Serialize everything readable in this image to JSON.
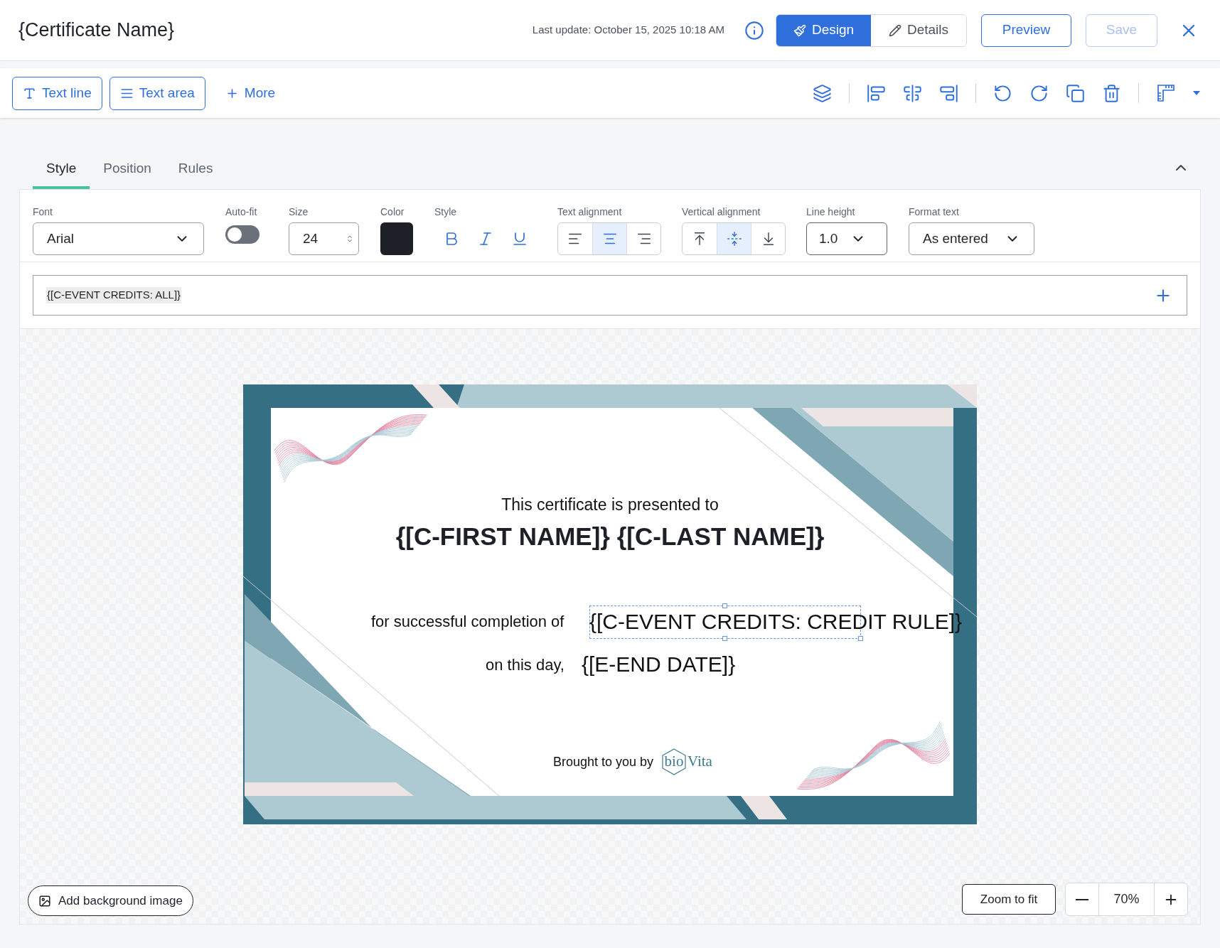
{
  "header": {
    "title": "{Certificate Name}",
    "last_update": "Last update: October 15, 2025 10:18 AM",
    "mode_tabs": [
      {
        "kind": "design",
        "label": "Design",
        "selected": true
      },
      {
        "kind": "details",
        "label": "Details",
        "selected": false
      }
    ],
    "preview": "Preview",
    "save": {
      "label": "Save",
      "disabled": true
    }
  },
  "toolbar": {
    "add_buttons": [
      {
        "kind": "text_line",
        "label": "Text line"
      },
      {
        "kind": "text_area",
        "label": "Text area"
      },
      {
        "kind": "more",
        "label": "More"
      }
    ]
  },
  "panel_tabs": [
    {
      "label": "Style",
      "selected": true
    },
    {
      "label": "Position",
      "selected": false
    },
    {
      "label": "Rules",
      "selected": false
    }
  ],
  "style": {
    "font": {
      "label": "Font",
      "value": "Arial"
    },
    "auto_fit": {
      "label": "Auto-fit",
      "on": false
    },
    "size": {
      "label": "Size",
      "value": "24"
    },
    "color": {
      "label": "Color",
      "color": "#1d2127"
    },
    "text_style": {
      "label": "Style"
    },
    "text_alignment": {
      "label": "Text alignment",
      "options": [
        {
          "kind": "left",
          "selected": false
        },
        {
          "kind": "center",
          "selected": true
        },
        {
          "kind": "right",
          "selected": false
        }
      ]
    },
    "vertical_alignment": {
      "label": "Vertical alignment",
      "options": [
        {
          "kind": "top",
          "selected": false
        },
        {
          "kind": "middle",
          "selected": true
        },
        {
          "kind": "bottom",
          "selected": false
        }
      ]
    },
    "line_height": {
      "label": "Line height",
      "value": "1.0"
    },
    "format_text": {
      "label": "Format text",
      "value": "As entered"
    }
  },
  "text_value": "{[C-EVENT CREDITS: ALL]}",
  "certificate": {
    "presented": "This certificate is presented to",
    "name": "{[C-FIRST NAME]} {[C-LAST NAME]}",
    "completion": "for successful completion of",
    "credit_field": "{[C-EVENT CREDITS: CREDIT RULE]}",
    "day": "on this day,",
    "date_field": "{[E-END DATE]}",
    "brought": "Brought to you by",
    "logo_left": "bio",
    "logo_right": "Vita"
  },
  "footer": {
    "add_background": "Add background image",
    "zoom_to_fit": "Zoom to fit",
    "zoom": "70%"
  }
}
